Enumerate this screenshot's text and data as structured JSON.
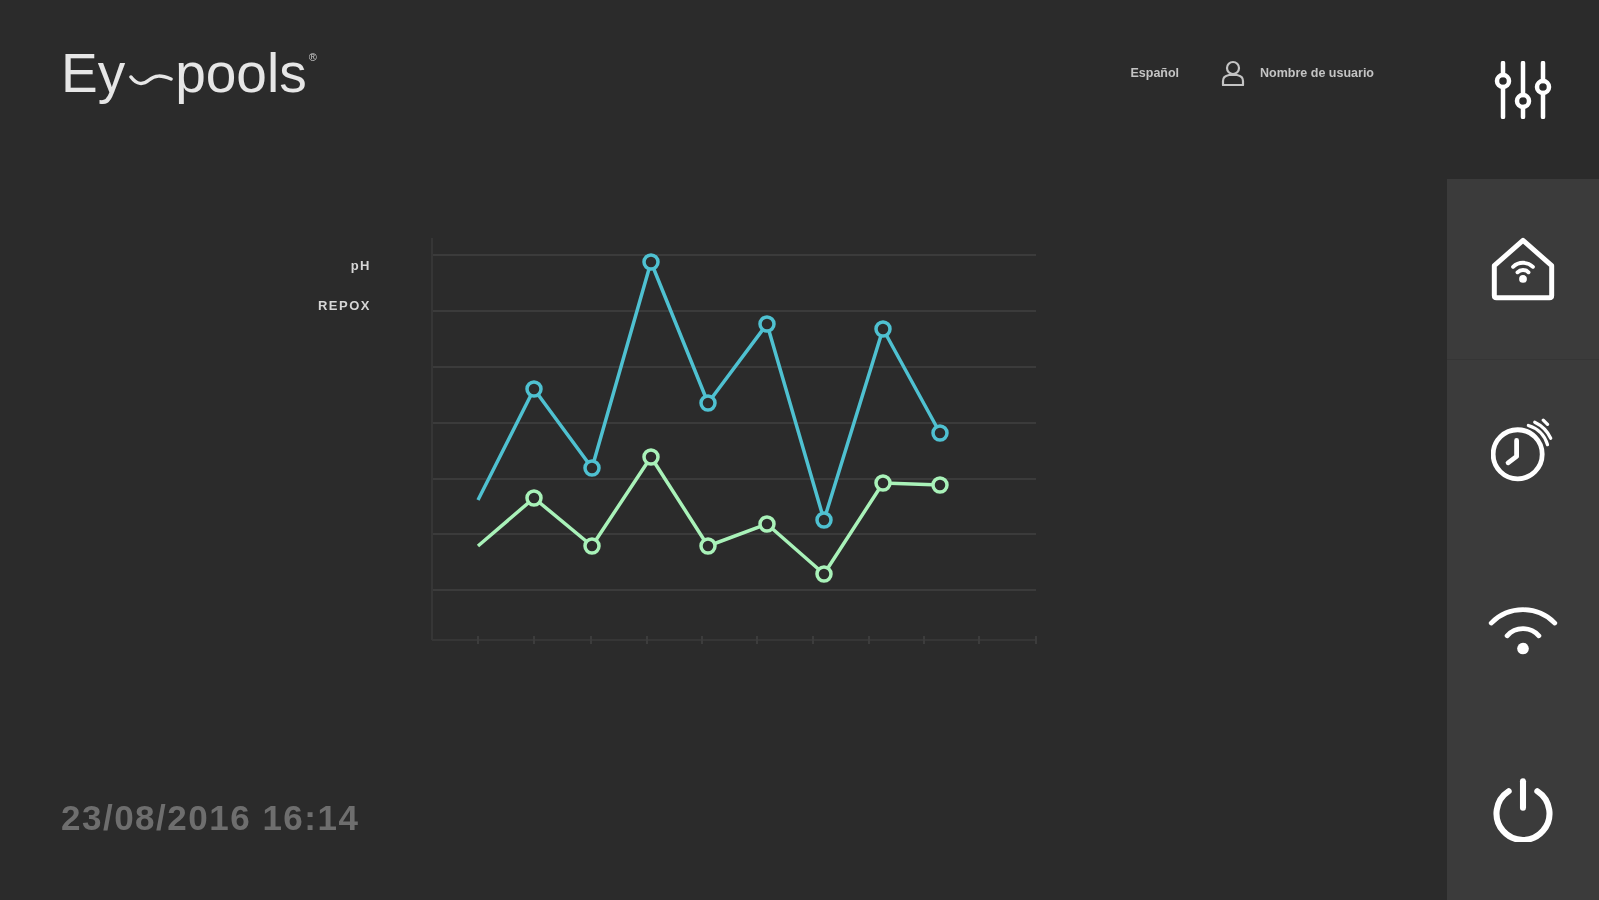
{
  "header": {
    "logo": {
      "left": "Ey",
      "right": "pools",
      "mark": "®"
    },
    "language": "Español",
    "user": "Nombre de usuario"
  },
  "chart": {
    "series_labels": [
      "pH",
      "REPOX"
    ]
  },
  "datetime": "23/08/2016 16:14",
  "sidebar": {
    "items": [
      {
        "kind": "home"
      },
      {
        "kind": "timer"
      },
      {
        "kind": "wifi"
      },
      {
        "kind": "power"
      }
    ]
  }
}
